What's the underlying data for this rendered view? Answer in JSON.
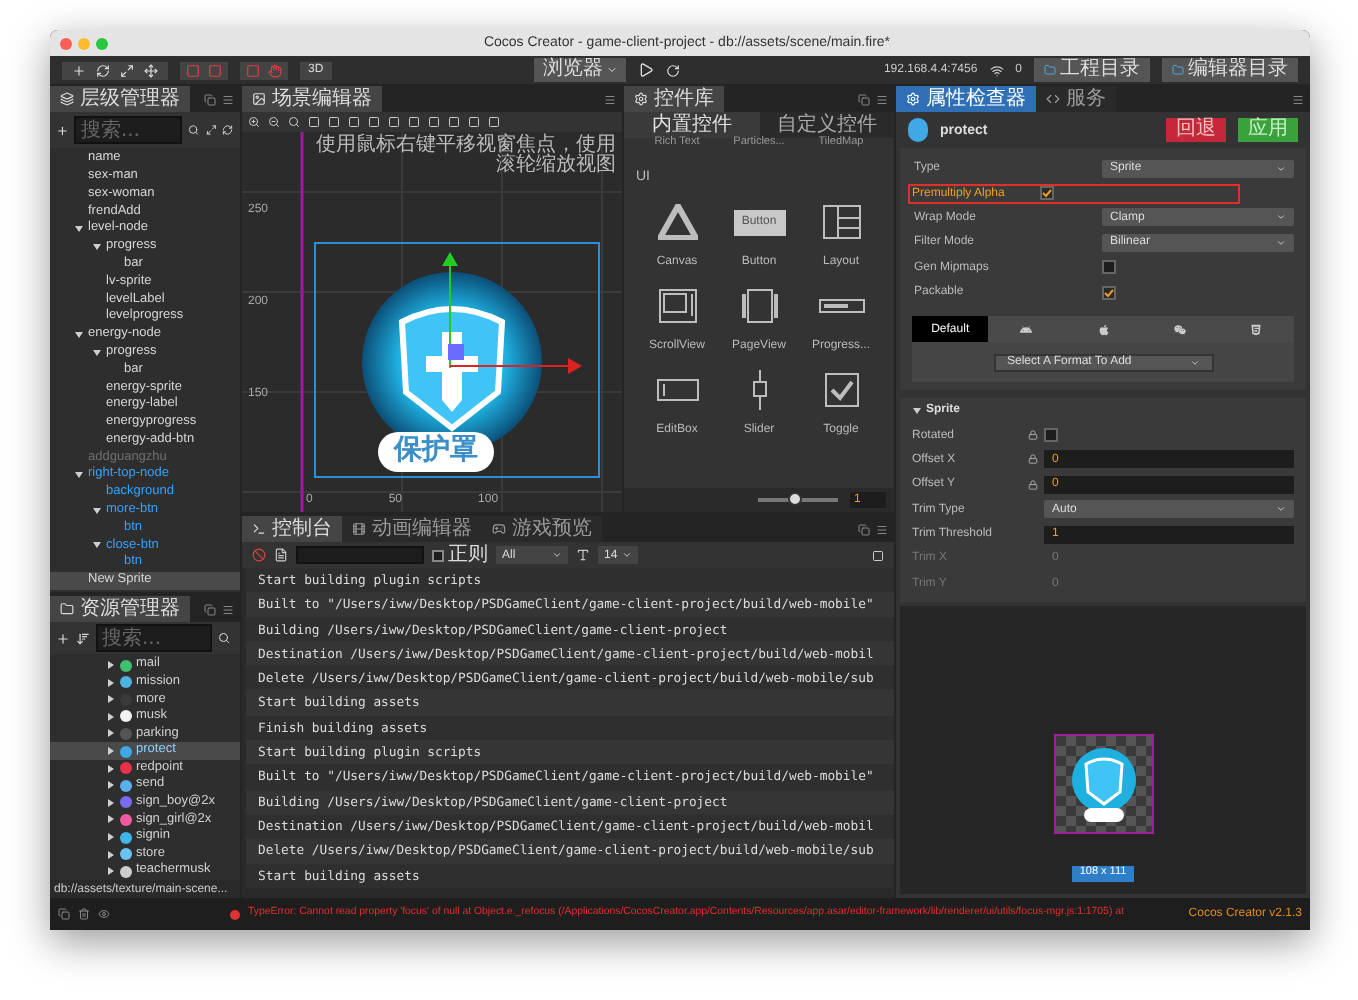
{
  "window": {
    "title": "Cocos Creator - game-client-project - db://assets/scene/main.fire*"
  },
  "toolbar": {
    "mode_button": "3D",
    "preview_select": "浏览器",
    "address": "192.168.4.4:7456",
    "connections": "0",
    "buttons": [
      "工程目录",
      "编辑器目录"
    ]
  },
  "hierarchy": {
    "title": "层级管理器",
    "search": {
      "placeholder": "搜索..."
    },
    "tree": [
      {
        "name": "name",
        "kind": "node",
        "selected": false
      },
      {
        "name": "sex-man",
        "kind": "node",
        "selected": false
      },
      {
        "name": "sex-woman",
        "kind": "node",
        "selected": false
      },
      {
        "name": "frendAdd",
        "kind": "node",
        "selected": false
      },
      {
        "name": "level-node",
        "kind": "node",
        "selected": false,
        "expanded": true,
        "children": [
          {
            "name": "progress",
            "kind": "node",
            "selected": false,
            "expanded": true,
            "children": [
              {
                "name": "bar",
                "kind": "node",
                "selected": false
              }
            ]
          },
          {
            "name": "lv-sprite",
            "kind": "node",
            "selected": false
          },
          {
            "name": "levelLabel",
            "kind": "node",
            "selected": false
          },
          {
            "name": "levelprogress",
            "kind": "node",
            "selected": false
          }
        ]
      },
      {
        "name": "energy-node",
        "kind": "node",
        "selected": false,
        "expanded": true,
        "children": [
          {
            "name": "progress",
            "kind": "node",
            "selected": false,
            "expanded": true,
            "children": [
              {
                "name": "bar",
                "kind": "node",
                "selected": false
              }
            ]
          },
          {
            "name": "energy-sprite",
            "kind": "node",
            "selected": false
          },
          {
            "name": "energy-label",
            "kind": "node",
            "selected": false
          },
          {
            "name": "energyprogress",
            "kind": "node",
            "selected": false
          },
          {
            "name": "energy-add-btn",
            "kind": "node",
            "selected": false
          }
        ]
      },
      {
        "name": "addguangzhu",
        "kind": "inactive",
        "selected": false
      },
      {
        "name": "right-top-node",
        "kind": "prefab",
        "selected": false,
        "expanded": true,
        "children": [
          {
            "name": "background",
            "kind": "prefab",
            "selected": false
          },
          {
            "name": "more-btn",
            "kind": "prefab",
            "selected": false,
            "expanded": true,
            "children": [
              {
                "name": "btn",
                "kind": "prefab",
                "selected": false
              }
            ]
          },
          {
            "name": "close-btn",
            "kind": "prefab",
            "selected": false,
            "expanded": true,
            "children": [
              {
                "name": "btn",
                "kind": "prefab",
                "selected": false
              }
            ]
          }
        ]
      },
      {
        "name": "New Sprite",
        "kind": "node",
        "selected": true
      }
    ]
  },
  "assets": {
    "title": "资源管理器",
    "search": {
      "placeholder": "搜索..."
    },
    "items": [
      {
        "name": "mail",
        "color": "#3fbf6f",
        "selected": false
      },
      {
        "name": "mission",
        "color": "#4fb3e0",
        "selected": false
      },
      {
        "name": "more",
        "color": "#3a3a3a",
        "selected": false
      },
      {
        "name": "musk",
        "color": "#f2f2f2",
        "selected": false
      },
      {
        "name": "parking",
        "color": "#555555",
        "selected": false
      },
      {
        "name": "protect",
        "color": "#3fa9e8",
        "selected": true
      },
      {
        "name": "redpoint",
        "color": "#e8324a",
        "selected": false
      },
      {
        "name": "send",
        "color": "#5ab0e8",
        "selected": false
      },
      {
        "name": "sign_boy@2x",
        "color": "#7a6cf0",
        "selected": false
      },
      {
        "name": "sign_girl@2x",
        "color": "#f05aa0",
        "selected": false
      },
      {
        "name": "signin",
        "color": "#3fb6e8",
        "selected": false
      },
      {
        "name": "store",
        "color": "#6ac3f0",
        "selected": false
      },
      {
        "name": "teachermusk",
        "color": "#cccccc",
        "selected": false
      }
    ],
    "path": "db://assets/texture/main-scene..."
  },
  "scene": {
    "title": "场景编辑器",
    "hint": "使用鼠标右键平移视窗焦点，使用滚轮缩放视图",
    "y_ruler": [
      "250",
      "200",
      "150"
    ],
    "x_ruler": [
      "0",
      "50",
      "100"
    ],
    "sprite_label": "保护罩"
  },
  "library": {
    "title": "控件库",
    "tabs": [
      {
        "label": "内置控件",
        "selected": true
      },
      {
        "label": "自定义控件",
        "selected": false
      }
    ],
    "cut_row": [
      "Rich Text",
      "Particles...",
      "TiledMap"
    ],
    "category": "UI",
    "items": [
      {
        "label": "Canvas",
        "kind": "canvas"
      },
      {
        "label": "Button",
        "kind": "button"
      },
      {
        "label": "Layout",
        "kind": "layout"
      },
      {
        "label": "ScrollView",
        "kind": "scrollview"
      },
      {
        "label": "PageView",
        "kind": "pageview"
      },
      {
        "label": "Progress...",
        "kind": "progress"
      },
      {
        "label": "EditBox",
        "kind": "editbox"
      },
      {
        "label": "Slider",
        "kind": "slider"
      },
      {
        "label": "Toggle",
        "kind": "toggle"
      }
    ],
    "button_preview_text": "Button",
    "zoom": {
      "level": 0.45,
      "value": "1"
    }
  },
  "console": {
    "tabs": [
      {
        "label": "控制台",
        "selected": true
      },
      {
        "label": "动画编辑器",
        "selected": false
      },
      {
        "label": "游戏预览",
        "selected": false
      }
    ],
    "regex": {
      "label": "正则",
      "checked": false
    },
    "level_select": "All",
    "font_size": "14",
    "lines": [
      "Start building plugin scripts",
      "Built to \"/Users/iww/Desktop/PSDGameClient/game-client-project/build/web-mobile\"",
      "Building /Users/iww/Desktop/PSDGameClient/game-client-project",
      "Destination /Users/iww/Desktop/PSDGameClient/game-client-project/build/web-mobil",
      "Delete /Users/iww/Desktop/PSDGameClient/game-client-project/build/web-mobile/sub",
      "Start building assets",
      "Finish building assets",
      "Start building plugin scripts",
      "Built to \"/Users/iww/Desktop/PSDGameClient/game-client-project/build/web-mobile\"",
      "Building /Users/iww/Desktop/PSDGameClient/game-client-project",
      "Destination /Users/iww/Desktop/PSDGameClient/game-client-project/build/web-mobil",
      "Delete /Users/iww/Desktop/PSDGameClient/game-client-project/build/web-mobile/sub",
      "Start building assets"
    ]
  },
  "inspector": {
    "tabs": [
      {
        "label": "属性检查器",
        "selected": true
      },
      {
        "label": "服务",
        "selected": false
      }
    ],
    "asset_name": "protect",
    "revert": "回退",
    "apply": "应用",
    "properties": [
      {
        "label": "Type",
        "kind": "select",
        "value": "Sprite",
        "highlighted": false
      },
      {
        "label": "Premultiply Alpha",
        "kind": "checkbox",
        "checked": true,
        "highlighted": true
      },
      {
        "label": "Wrap Mode",
        "kind": "select",
        "value": "Clamp",
        "highlighted": false
      },
      {
        "label": "Filter Mode",
        "kind": "select",
        "value": "Bilinear",
        "highlighted": false
      },
      {
        "label": "Gen Mipmaps",
        "kind": "checkbox",
        "checked": false,
        "highlighted": false
      },
      {
        "label": "Packable",
        "kind": "checkbox",
        "checked": true,
        "highlighted": false
      }
    ],
    "platforms": [
      {
        "kind": "default",
        "label": "Default",
        "selected": true
      },
      {
        "kind": "android",
        "selected": false
      },
      {
        "kind": "ios",
        "selected": false
      },
      {
        "kind": "wechat",
        "selected": false
      },
      {
        "kind": "html5",
        "selected": false
      }
    ],
    "format_select": "Select A Format To Add",
    "section": {
      "title": "Sprite",
      "expanded": true,
      "properties": [
        {
          "label": "Rotated",
          "kind": "checkbox",
          "checked": false,
          "locked": true,
          "disabled": false
        },
        {
          "label": "Offset X",
          "kind": "number",
          "value": "0",
          "locked": true,
          "disabled": false
        },
        {
          "label": "Offset Y",
          "kind": "number",
          "value": "0",
          "locked": true,
          "disabled": false
        },
        {
          "label": "Trim Type",
          "kind": "select",
          "value": "Auto",
          "locked": false,
          "disabled": false
        },
        {
          "label": "Trim Threshold",
          "kind": "number",
          "value": "1",
          "locked": false,
          "disabled": false
        },
        {
          "label": "Trim X",
          "kind": "number",
          "value": "0",
          "locked": false,
          "disabled": true
        },
        {
          "label": "Trim Y",
          "kind": "number",
          "value": "0",
          "locked": false,
          "disabled": true
        }
      ]
    },
    "preview": {
      "size": "108 x 111"
    }
  },
  "status_bar": {
    "error": "TypeError: Cannot read property 'focus' of null at Object.e._refocus (/Applications/CocosCreator.app/Contents/Resources/app.asar/editor-framework/lib/renderer/ui/utils/focus-mgr.js:1:1705) at",
    "version": "Cocos Creator v2.1.3"
  }
}
